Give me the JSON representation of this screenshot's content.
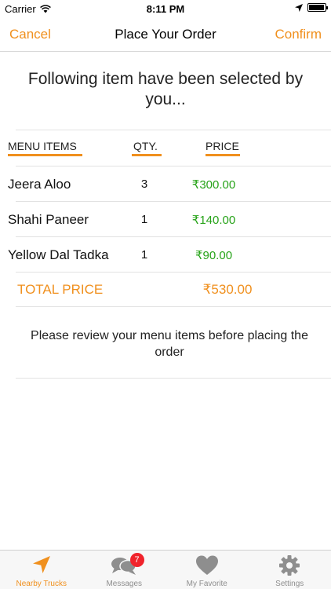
{
  "status_bar": {
    "carrier": "Carrier",
    "time": "8:11 PM"
  },
  "nav": {
    "cancel": "Cancel",
    "title": "Place Your Order",
    "confirm": "Confirm"
  },
  "headline": "Following item have been selected by you...",
  "columns": {
    "items": "MENU ITEMS",
    "qty": "QTY.",
    "price": "PRICE"
  },
  "order_items": [
    {
      "name": "Jeera Aloo",
      "qty": "3",
      "price": "₹300.00"
    },
    {
      "name": "Shahi Paneer",
      "qty": "1",
      "price": "₹140.00"
    },
    {
      "name": "Yellow Dal Tadka",
      "qty": "1",
      "price": "₹90.00"
    }
  ],
  "total": {
    "label": "TOTAL PRICE",
    "value": "₹530.00"
  },
  "review_note": "Please review your menu items before placing the order",
  "tab_bar": {
    "tabs": [
      {
        "label": "Nearby Trucks",
        "icon": "location-arrow-icon",
        "active": true
      },
      {
        "label": "Messages",
        "icon": "chat-bubbles-icon",
        "badge": "7"
      },
      {
        "label": "My Favorite",
        "icon": "heart-icon"
      },
      {
        "label": "Settings",
        "icon": "gear-icon"
      }
    ]
  },
  "colors": {
    "accent": "#f0901e",
    "price_green": "#27a319",
    "badge_red": "#f0232b"
  }
}
